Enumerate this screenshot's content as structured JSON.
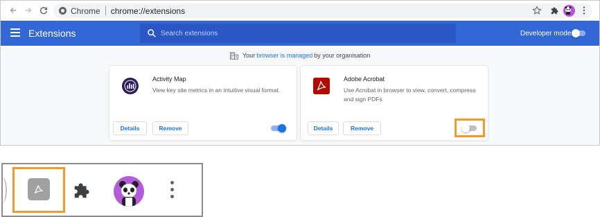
{
  "browser": {
    "site_chip": "Chrome",
    "url": "chrome://extensions"
  },
  "header": {
    "title": "Extensions",
    "search_placeholder": "Search extensions",
    "developer_mode_label": "Developer mode",
    "developer_mode_on": false,
    "accent_color": "#3367d6"
  },
  "managed_notice": {
    "prefix": "Your",
    "link": "browser is managed",
    "suffix": "by your organisation"
  },
  "extensions": [
    {
      "name": "Activity Map",
      "description": "View key site metrics in an intuitive visual format.",
      "details_label": "Details",
      "remove_label": "Remove",
      "enabled": true,
      "icon": "activity-map-icon"
    },
    {
      "name": "Adobe Acrobat",
      "description": "Use Acrobat in browser to view, convert, compress and sign PDFs",
      "details_label": "Details",
      "remove_label": "Remove",
      "enabled": false,
      "icon": "acrobat-icon"
    }
  ],
  "highlight_color": "#f29b2b",
  "toolbar_icons": [
    "star-icon",
    "puzzle-icon",
    "avatar",
    "menu-icon"
  ],
  "zoom_icons": [
    "acrobat-icon",
    "puzzle-icon",
    "avatar",
    "menu-icon"
  ]
}
